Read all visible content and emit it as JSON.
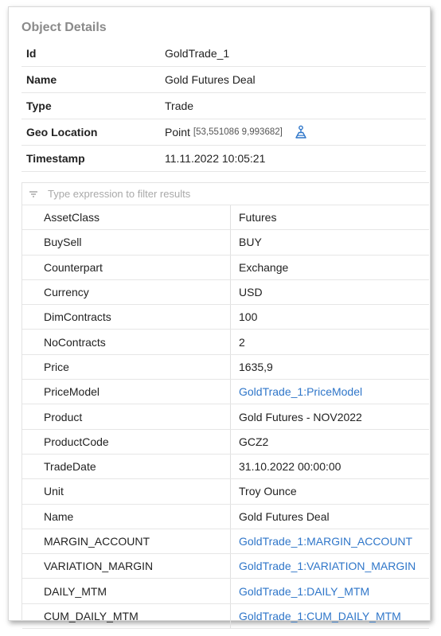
{
  "panel": {
    "title": "Object Details"
  },
  "properties": [
    {
      "key": "Id",
      "value": "GoldTrade_1"
    },
    {
      "key": "Name",
      "value": "Gold Futures Deal"
    },
    {
      "key": "Type",
      "value": "Trade"
    },
    {
      "key": "Geo Location",
      "value": "Point",
      "coords": "[53,551086 9,993682]"
    },
    {
      "key": "Timestamp",
      "value": "11.11.2022 10:05:21"
    }
  ],
  "filter": {
    "placeholder": "Type expression to filter results"
  },
  "attributes": [
    {
      "key": "AssetClass",
      "value": "Futures",
      "link": false
    },
    {
      "key": "BuySell",
      "value": "BUY",
      "link": false
    },
    {
      "key": "Counterpart",
      "value": "Exchange",
      "link": false
    },
    {
      "key": "Currency",
      "value": "USD",
      "link": false
    },
    {
      "key": "DimContracts",
      "value": "100",
      "link": false
    },
    {
      "key": "NoContracts",
      "value": "2",
      "link": false
    },
    {
      "key": "Price",
      "value": "1635,9",
      "link": false
    },
    {
      "key": "PriceModel",
      "value": "GoldTrade_1:PriceModel",
      "link": true
    },
    {
      "key": "Product",
      "value": "Gold Futures - NOV2022",
      "link": false
    },
    {
      "key": "ProductCode",
      "value": "GCZ2",
      "link": false
    },
    {
      "key": "TradeDate",
      "value": "31.10.2022 00:00:00",
      "link": false
    },
    {
      "key": "Unit",
      "value": "Troy Ounce",
      "link": false
    },
    {
      "key": "Name",
      "value": "Gold Futures Deal",
      "link": false
    },
    {
      "key": "MARGIN_ACCOUNT",
      "value": "GoldTrade_1:MARGIN_ACCOUNT",
      "link": true
    },
    {
      "key": "VARIATION_MARGIN",
      "value": "GoldTrade_1:VARIATION_MARGIN",
      "link": true
    },
    {
      "key": "DAILY_MTM",
      "value": "GoldTrade_1:DAILY_MTM",
      "link": true
    },
    {
      "key": "CUM_DAILY_MTM",
      "value": "GoldTrade_1:CUM_DAILY_MTM",
      "link": true
    }
  ],
  "colors": {
    "link": "#2f76c9",
    "title": "#8a8a8a",
    "icon": "#2f76c9"
  },
  "icons": {
    "geo": "map-locate-icon",
    "filter": "filter-icon"
  }
}
